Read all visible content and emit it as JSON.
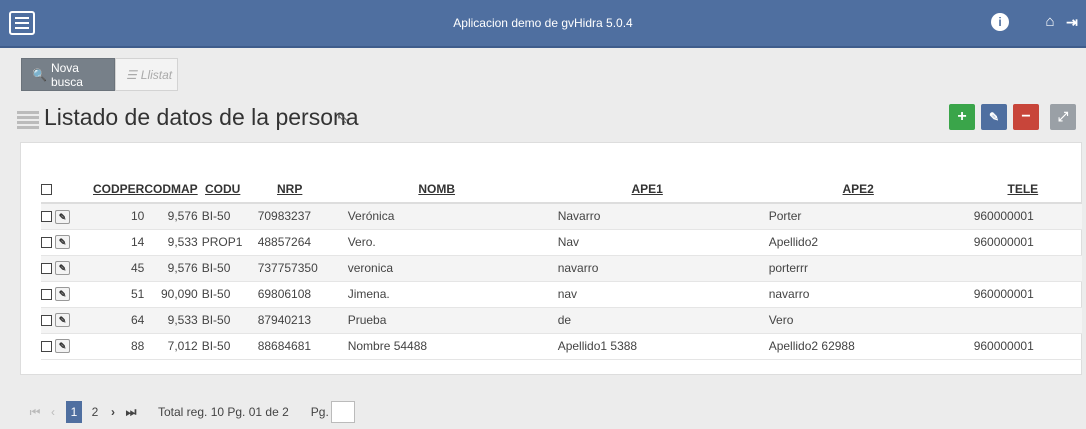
{
  "header": {
    "title": "Aplicacion demo de gvHidra 5.0.4"
  },
  "tabs": {
    "search": "Nova busca",
    "list": "Llistat"
  },
  "page": {
    "title": "Listado de datos de la persona"
  },
  "actions": {
    "add": "+",
    "edit": "✎",
    "delete": "−",
    "expand": "⤢"
  },
  "table": {
    "headers": [
      "CODPER",
      "CODMAP",
      "CODU",
      "NRP",
      "NOMB",
      "APE1",
      "APE2",
      "TELE"
    ],
    "rows": [
      [
        "10",
        "9,576",
        "BI-50",
        "70983237",
        "Verónica",
        "Navarro",
        "Porter",
        "960000001"
      ],
      [
        "14",
        "9,533",
        "PROP1",
        "48857264",
        "Vero.",
        "Nav",
        "Apellido2",
        "960000001"
      ],
      [
        "45",
        "9,576",
        "BI-50",
        "737757350",
        "veronica",
        "navarro",
        "porterrr",
        ""
      ],
      [
        "51",
        "90,090",
        "BI-50",
        "69806108",
        "Jimena.",
        "nav",
        "navarro",
        "960000001"
      ],
      [
        "64",
        "9,533",
        "BI-50",
        "87940213",
        "Prueba",
        "de",
        "Vero",
        ""
      ],
      [
        "88",
        "7,012",
        "BI-50",
        "88684681",
        "Nombre 54488",
        "Apellido1 5388",
        "Apellido2 62988",
        "960000001"
      ]
    ]
  },
  "pager": {
    "first": "⏮",
    "prev": "‹",
    "pages": [
      "1",
      "2"
    ],
    "next": "›",
    "last": "⏭",
    "total": "Total reg. 10 Pg. 01 de 2",
    "page_label": "Pg."
  }
}
